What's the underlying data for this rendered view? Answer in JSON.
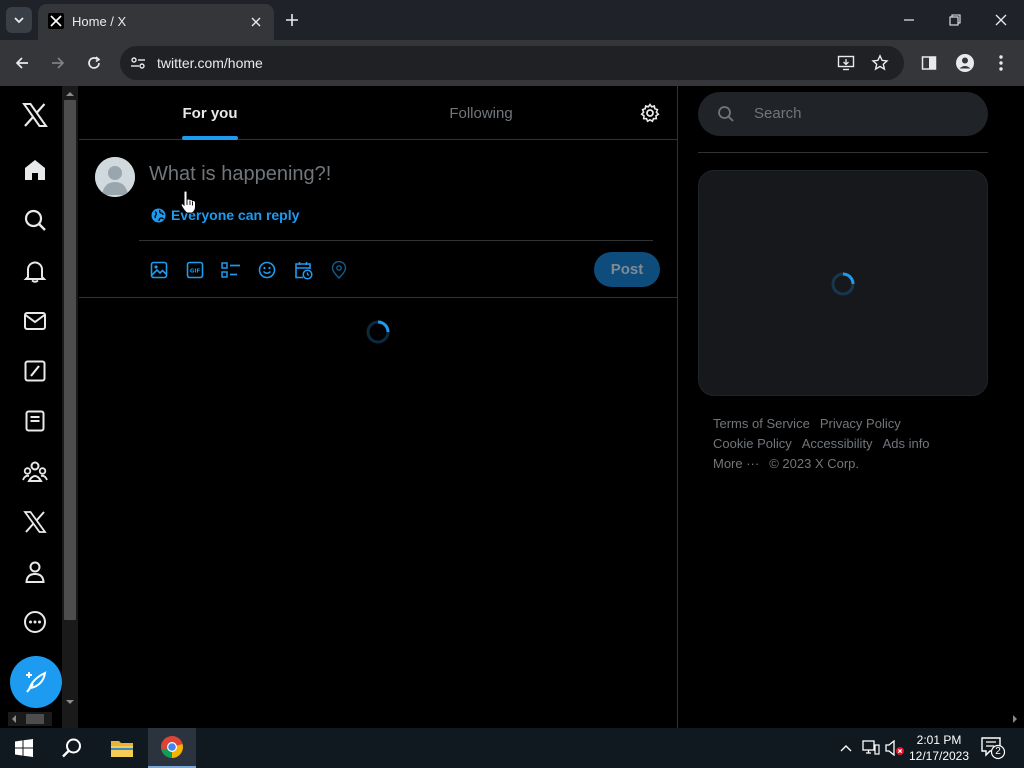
{
  "browser": {
    "tab_title": "Home / X",
    "url": "twitter.com/home"
  },
  "feed": {
    "tabs": [
      {
        "label": "For you",
        "active": true
      },
      {
        "label": "Following",
        "active": false
      }
    ]
  },
  "composer": {
    "placeholder": "What is happening?!",
    "reply_setting": "Everyone can reply",
    "post_label": "Post",
    "tools": [
      "media-icon",
      "gif-icon",
      "poll-icon",
      "emoji-icon",
      "schedule-icon",
      "location-icon"
    ]
  },
  "sidebar_nav": [
    "x-logo-icon",
    "home-icon",
    "explore-icon",
    "notifications-icon",
    "messages-icon",
    "grok-icon",
    "lists-icon",
    "communities-icon",
    "premium-icon",
    "profile-icon",
    "more-icon",
    "compose-post-icon"
  ],
  "search": {
    "placeholder": "Search"
  },
  "footer": {
    "terms": "Terms of Service",
    "privacy": "Privacy Policy",
    "cookie": "Cookie Policy",
    "accessibility": "Accessibility",
    "ads": "Ads info",
    "more": "More ···",
    "copyright": "© 2023 X Corp."
  },
  "taskbar": {
    "time": "2:01 PM",
    "date": "12/17/2023",
    "notification_count": "2"
  },
  "colors": {
    "accent": "#1d9bf0",
    "background": "#000000",
    "border": "#2f3336",
    "muted_text": "#71767b"
  }
}
